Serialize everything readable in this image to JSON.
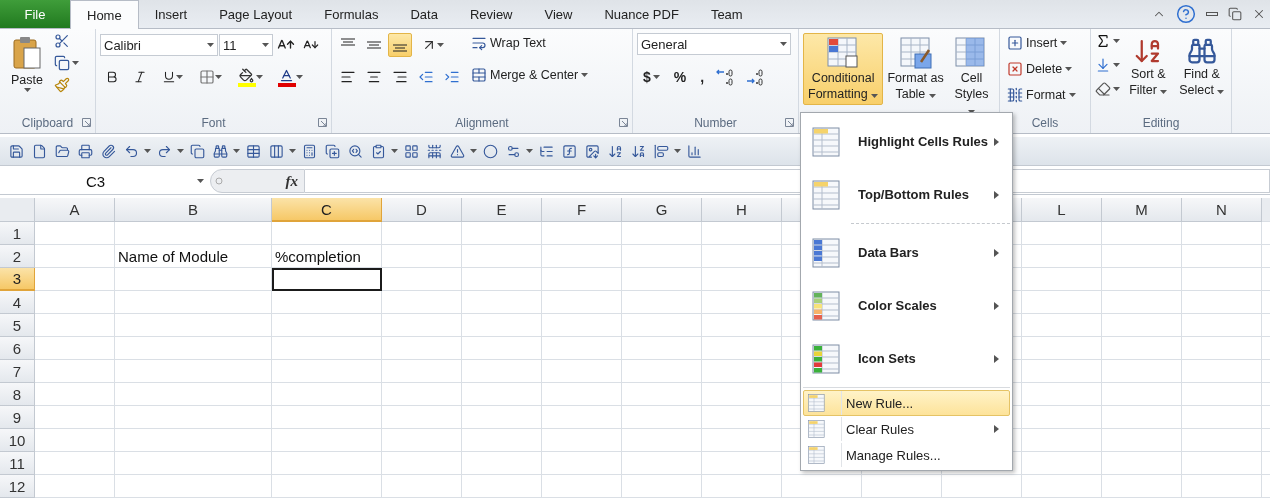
{
  "tabs": [
    {
      "label": "File",
      "kind": "file",
      "selected": false
    },
    {
      "label": "Home",
      "kind": "tab",
      "selected": true
    },
    {
      "label": "Insert",
      "kind": "tab",
      "selected": false
    },
    {
      "label": "Page Layout",
      "kind": "tab",
      "selected": false
    },
    {
      "label": "Formulas",
      "kind": "tab",
      "selected": false
    },
    {
      "label": "Data",
      "kind": "tab",
      "selected": false
    },
    {
      "label": "Review",
      "kind": "tab",
      "selected": false
    },
    {
      "label": "View",
      "kind": "tab",
      "selected": false
    },
    {
      "label": "Nuance PDF",
      "kind": "tab",
      "selected": false
    },
    {
      "label": "Team",
      "kind": "tab",
      "selected": false
    }
  ],
  "ribbon": {
    "clipboard": {
      "label": "Clipboard",
      "paste": "Paste"
    },
    "font": {
      "label": "Font",
      "font_name": "Calibri",
      "font_size": "11"
    },
    "alignment": {
      "label": "Alignment",
      "vertical": [
        {
          "selected": false
        },
        {
          "selected": false
        },
        {
          "selected": true
        }
      ],
      "wrap_text": "Wrap Text",
      "merge": "Merge & Center"
    },
    "number": {
      "label": "Number",
      "format": "General",
      "symbols": [
        "$",
        "%",
        ","
      ]
    },
    "styles": {
      "buttons": [
        {
          "label": "Conditional Formatting",
          "selected": true
        },
        {
          "label": "Format as Table",
          "selected": false
        },
        {
          "label": "Cell Styles",
          "selected": false
        }
      ]
    },
    "cells": {
      "label": "Cells",
      "buttons": [
        "Insert",
        "Delete",
        "Format"
      ]
    },
    "editing": {
      "label": "Editing",
      "buttons": [
        "Sort & Filter",
        "Find & Select"
      ]
    }
  },
  "formula_bar": {
    "name_box": "C3",
    "function_label": "fx"
  },
  "sheet": {
    "columns": [
      {
        "label": "A",
        "selected": false
      },
      {
        "label": "B",
        "selected": false
      },
      {
        "label": "C",
        "selected": true
      },
      {
        "label": "D",
        "selected": false
      },
      {
        "label": "E",
        "selected": false
      },
      {
        "label": "F",
        "selected": false
      },
      {
        "label": "G",
        "selected": false
      },
      {
        "label": "H",
        "selected": false
      }
    ],
    "columns_right": [
      {
        "label": "L",
        "selected": false
      },
      {
        "label": "M",
        "selected": false
      },
      {
        "label": "N",
        "selected": false
      }
    ],
    "rows": [
      {
        "label": "1",
        "selected": false
      },
      {
        "label": "2",
        "selected": false,
        "cells": [
          null,
          "Name of Module",
          "%completion"
        ]
      },
      {
        "label": "3",
        "selected": true
      },
      {
        "label": "4",
        "selected": false
      },
      {
        "label": "5",
        "selected": false
      },
      {
        "label": "6",
        "selected": false
      },
      {
        "label": "7",
        "selected": false
      },
      {
        "label": "8",
        "selected": false
      },
      {
        "label": "9",
        "selected": false
      },
      {
        "label": "10",
        "selected": false
      },
      {
        "label": "11",
        "selected": false
      },
      {
        "label": "12",
        "selected": false
      }
    ]
  },
  "menu": {
    "items": [
      {
        "kind": "large",
        "label": "Highlight Cells Rules",
        "submenu": true,
        "selected": false
      },
      {
        "kind": "large",
        "label": "Top/Bottom Rules",
        "submenu": true,
        "selected": false
      },
      {
        "kind": "separator"
      },
      {
        "kind": "large",
        "label": "Data Bars",
        "submenu": true,
        "selected": false
      },
      {
        "kind": "large",
        "label": "Color Scales",
        "submenu": true,
        "selected": false
      },
      {
        "kind": "large",
        "label": "Icon Sets",
        "submenu": true,
        "selected": false
      },
      {
        "kind": "separator"
      },
      {
        "kind": "small",
        "label": "New Rule...",
        "submenu": false,
        "selected": true
      },
      {
        "kind": "small",
        "label": "Clear Rules",
        "submenu": true,
        "selected": false
      },
      {
        "kind": "small",
        "label": "Manage Rules...",
        "submenu": false,
        "selected": false
      }
    ]
  }
}
